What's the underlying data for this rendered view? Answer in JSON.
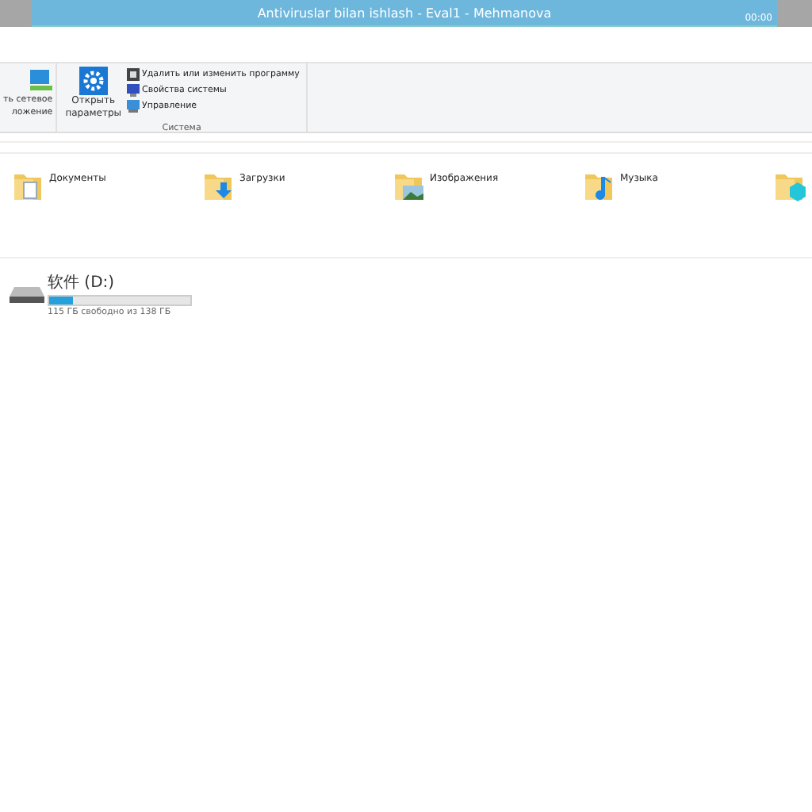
{
  "window": {
    "title": "Antiviruslar bilan ishlash - Eval1 - Mehmanova",
    "timer": "00:00"
  },
  "ribbon": {
    "cut_button": [
      "ть сетевое",
      "ложение"
    ],
    "open_button": [
      "Открыть",
      "параметры"
    ],
    "commands": [
      {
        "label": "Удалить или изменить программу",
        "kind": "uninstall"
      },
      {
        "label": "Свойства системы",
        "kind": "properties"
      },
      {
        "label": "Управление",
        "kind": "manage"
      }
    ],
    "group_label": "Система"
  },
  "folders": [
    {
      "name": "Документы",
      "kind": "documents"
    },
    {
      "name": "Загрузки",
      "kind": "downloads"
    },
    {
      "name": "Изображения",
      "kind": "pictures"
    },
    {
      "name": "Музыка",
      "kind": "music"
    },
    {
      "kind": "objects"
    }
  ],
  "drives": [
    {
      "name": "软件 (D:)",
      "level": 0.17,
      "free": "115 ГБ свободно из 138 ГБ"
    }
  ]
}
